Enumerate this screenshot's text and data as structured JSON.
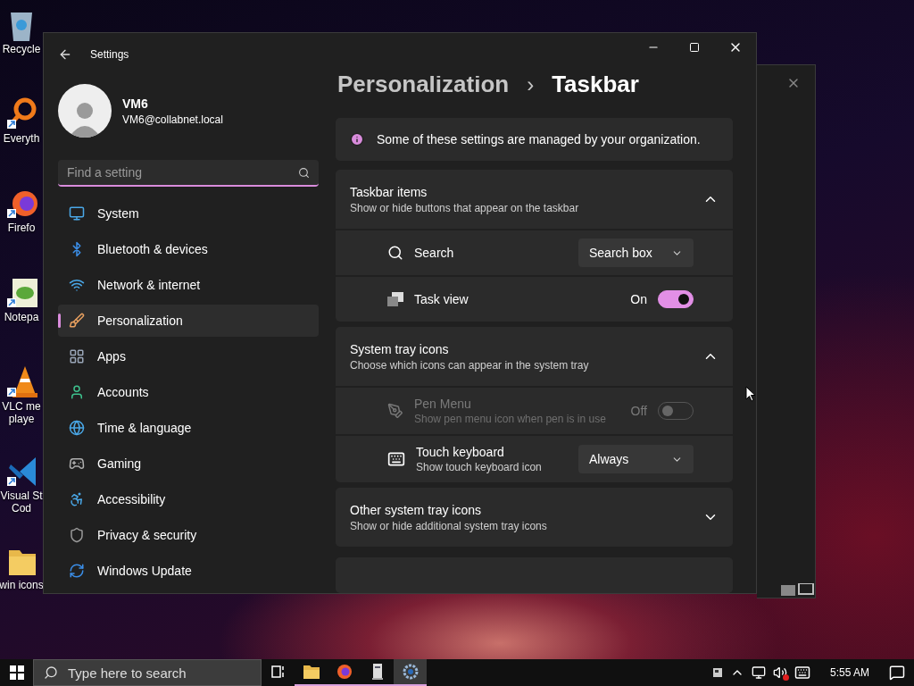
{
  "desktop_icons": [
    {
      "lines": [
        "Recycle"
      ]
    },
    {
      "lines": [
        "Everyth"
      ]
    },
    {
      "lines": [
        "Firefo"
      ]
    },
    {
      "lines": [
        "Notepa"
      ]
    },
    {
      "lines": [
        "VLC me",
        "playe"
      ]
    },
    {
      "lines": [
        "Visual St",
        "Cod"
      ]
    },
    {
      "lines": [
        "win icons"
      ]
    }
  ],
  "window": {
    "title": "Settings"
  },
  "profile": {
    "name": "VM6",
    "email": "VM6@collabnet.local"
  },
  "search": {
    "placeholder": "Find a setting"
  },
  "nav": [
    {
      "label": "System",
      "selected": false
    },
    {
      "label": "Bluetooth & devices",
      "selected": false
    },
    {
      "label": "Network & internet",
      "selected": false
    },
    {
      "label": "Personalization",
      "selected": true
    },
    {
      "label": "Apps",
      "selected": false
    },
    {
      "label": "Accounts",
      "selected": false
    },
    {
      "label": "Time & language",
      "selected": false
    },
    {
      "label": "Gaming",
      "selected": false
    },
    {
      "label": "Accessibility",
      "selected": false
    },
    {
      "label": "Privacy & security",
      "selected": false
    },
    {
      "label": "Windows Update",
      "selected": false
    }
  ],
  "breadcrumb": {
    "parent": "Personalization",
    "separator": "›",
    "current": "Taskbar"
  },
  "notice": "Some of these settings are managed by your organization.",
  "groups": [
    {
      "title": "Taskbar items",
      "subtitle": "Show or hide buttons that appear on the taskbar",
      "expanded": true,
      "rows": [
        {
          "kind": "dropdown",
          "label": "Search",
          "value": "Search box",
          "disabled": false
        },
        {
          "kind": "toggle",
          "label": "Task view",
          "state_label": "On",
          "on": true,
          "disabled": false
        }
      ]
    },
    {
      "title": "System tray icons",
      "subtitle": "Choose which icons can appear in the system tray",
      "expanded": true,
      "rows": [
        {
          "kind": "toggle",
          "label": "Pen Menu",
          "description": "Show pen menu icon when pen is in use",
          "state_label": "Off",
          "on": false,
          "disabled": true
        },
        {
          "kind": "dropdown",
          "label": "Touch keyboard",
          "description": "Show touch keyboard icon",
          "value": "Always",
          "disabled": false
        }
      ]
    },
    {
      "title": "Other system tray icons",
      "subtitle": "Show or hide additional system tray icons",
      "expanded": false
    }
  ],
  "taskbar": {
    "search_placeholder": "Type here to search",
    "apps": [
      {
        "selected": false
      },
      {
        "selected": false
      },
      {
        "selected": false
      },
      {
        "selected": true
      }
    ],
    "clock": "5:55 AM"
  }
}
